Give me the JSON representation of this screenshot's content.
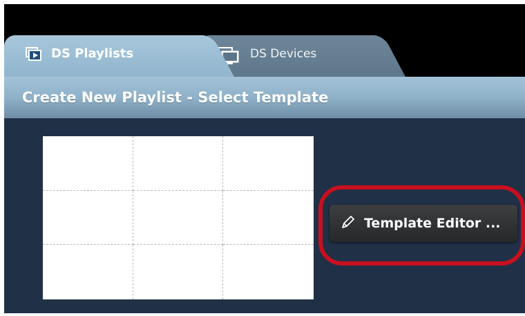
{
  "tabs": [
    {
      "label": "DS Playlists",
      "icon": "playlist-icon",
      "active": true
    },
    {
      "label": "DS Devices",
      "icon": "devices-icon",
      "active": false
    }
  ],
  "header": {
    "title": "Create New Playlist - Select Template"
  },
  "template": {
    "rows": 3,
    "columns": 3
  },
  "actions": {
    "template_editor_label": "Template Editor ...",
    "icon": "pencil-icon"
  },
  "colors": {
    "content_background": "#203047",
    "header_accent": "#8fb2c9",
    "highlight_ring": "#c8101e",
    "button_background": "#2f3032"
  }
}
